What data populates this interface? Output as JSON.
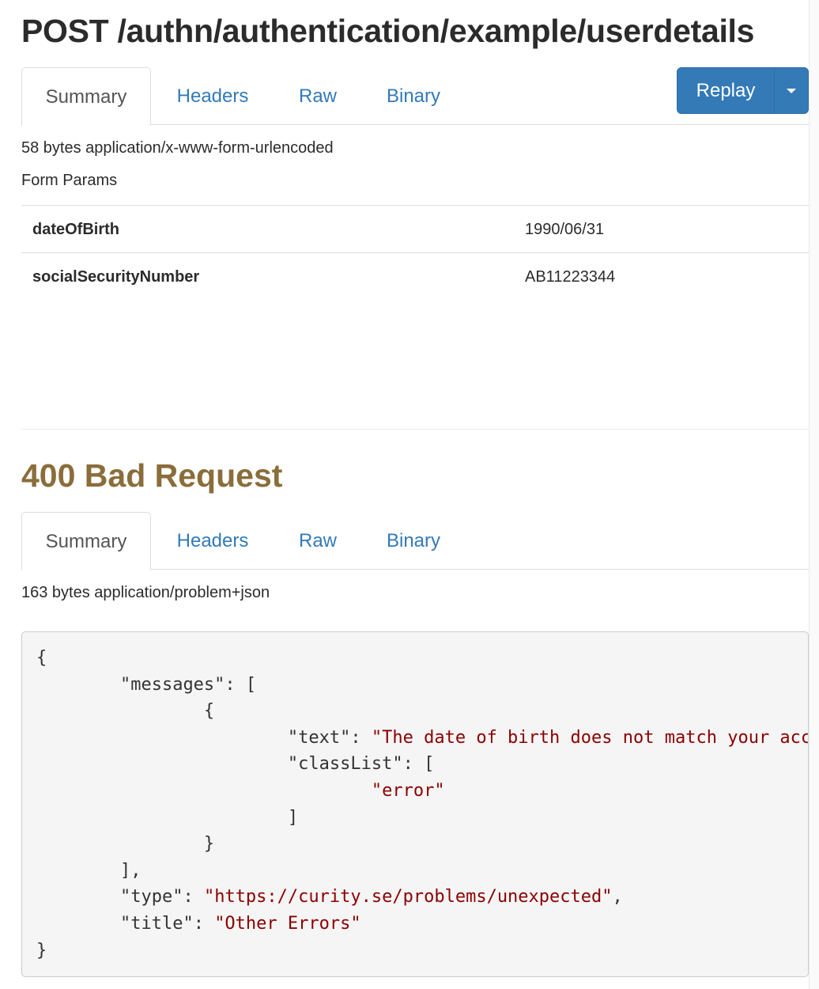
{
  "request": {
    "title": "POST /authn/authentication/example/userdetails",
    "tabs": [
      {
        "label": "Summary",
        "active": true
      },
      {
        "label": "Headers",
        "active": false
      },
      {
        "label": "Raw",
        "active": false
      },
      {
        "label": "Binary",
        "active": false
      }
    ],
    "replay_button": {
      "label": "Replay",
      "dropdown_icon": "caret-down-icon"
    },
    "body_info": "58 bytes application/x-www-form-urlencoded",
    "form_params_label": "Form Params",
    "form_params": [
      {
        "name": "dateOfBirth",
        "value": "1990/06/31"
      },
      {
        "name": "socialSecurityNumber",
        "value": "AB11223344"
      }
    ]
  },
  "response": {
    "status": "400 Bad Request",
    "status_color": "#8a6d3b",
    "tabs": [
      {
        "label": "Summary",
        "active": true
      },
      {
        "label": "Headers",
        "active": false
      },
      {
        "label": "Raw",
        "active": false
      },
      {
        "label": "Binary",
        "active": false
      }
    ],
    "body_info": "163 bytes application/problem+json",
    "json_body": {
      "open_brace": "{",
      "messages_key": "\"messages\"",
      "messages_open": ": [",
      "message_open": "{",
      "text_key": "\"text\"",
      "text_sep": ": ",
      "text_value": "\"The date of birth does not match your account\"",
      "text_comma": ",",
      "classlist_key": "\"classList\"",
      "classlist_open": ": [",
      "classlist_item": "\"error\"",
      "classlist_close": "]",
      "message_close": "}",
      "messages_close": "],",
      "type_key": "\"type\"",
      "type_sep": ": ",
      "type_value": "\"https://curity.se/problems/unexpected\"",
      "type_comma": ",",
      "title_key": "\"title\"",
      "title_sep": ": ",
      "title_value": "\"Other Errors\"",
      "close_brace": "}"
    }
  },
  "colors": {
    "link": "#337ab7",
    "button_primary": "#337ab7",
    "json_string": "#8b0000",
    "warning_text": "#8a6d3b"
  }
}
